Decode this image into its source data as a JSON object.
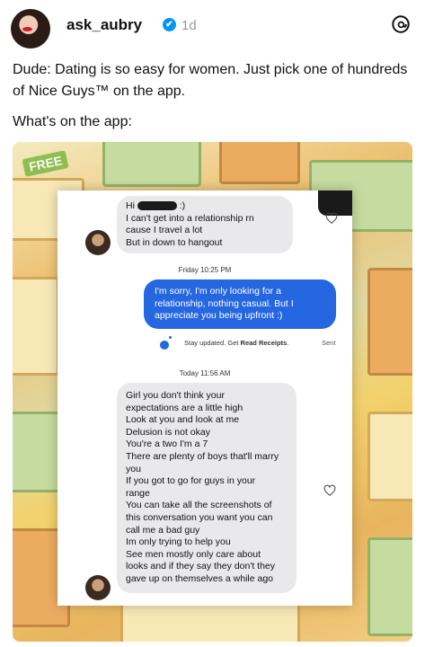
{
  "post": {
    "username": "ask_aubry",
    "verified_mark": "✔",
    "time": "1d",
    "icon": "threads-logo-icon",
    "paragraphs": [
      "Dude: Dating is so easy for women. Just pick one of hundreds of Nice Guys™ on the app.",
      "What's on the app:"
    ]
  },
  "media": {
    "badge": "FREE",
    "chat": {
      "first_message": {
        "line1_prefix": "Hi",
        "line1_suffix": ":)",
        "lines": [
          "I can't get into a relationship rn",
          "cause I travel a lot",
          "But in down to hangout"
        ]
      },
      "divider1": "Friday 10:25 PM",
      "reply_lines": [
        "I'm sorry, I'm only looking for a",
        "relationship, nothing casual. But I",
        "appreciate you being upfront :)"
      ],
      "receipt": {
        "text": "Stay updated. Get ",
        "bold": "Read Receipts",
        "suffix": ".",
        "status": "Sent"
      },
      "divider2": "Today 11:56 AM",
      "long_message_lines": [
        "Girl you don't think your",
        "expectations are a little high",
        "Look at you and look at me",
        "Delusion is not okay",
        "You're a two I'm a 7",
        "There are plenty of boys that'll marry",
        "you",
        "If you got to go for guys in your",
        "range",
        "You can take all the screenshots of",
        "this conversation you want you can",
        "call me a bad guy",
        "Im only trying to help you",
        "See men mostly only care about",
        "looks and if they say they don't they",
        "gave up on themselves a while ago"
      ]
    }
  },
  "colors": {
    "outgoing_bubble": "#2467e0",
    "incoming_bubble": "#e9e9eb",
    "verified": "#0095f6"
  }
}
